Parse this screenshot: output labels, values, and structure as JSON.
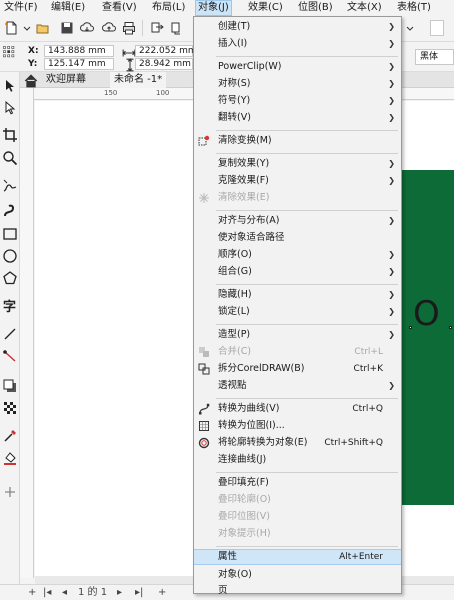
{
  "menubar": {
    "items": [
      "文件(F)",
      "编辑(E)",
      "查看(V)",
      "布局(L)",
      "对象(J)",
      "效果(C)",
      "位图(B)",
      "文本(X)",
      "表格(T)"
    ]
  },
  "propbar": {
    "x_label": "X:",
    "x_value": "143.888 mm",
    "y_label": "Y:",
    "y_value": "125.147 mm",
    "w_value": "222.052 mm",
    "h_value": "28.942 mm",
    "font_name": "黑体"
  },
  "doctabs": {
    "welcome": "欢迎屏幕",
    "untitled": "未命名 -1*"
  },
  "ruler": {
    "h150": "150",
    "h100": "100"
  },
  "canvas": {
    "letter": "O",
    "accent_color": "#0c6b37"
  },
  "pagebar": {
    "page_info": "1 的 1",
    "add_label": "+"
  },
  "dropdown": {
    "items": [
      {
        "label": "创建(T)",
        "shortcut": "",
        "submenu": true,
        "disabled": false
      },
      {
        "label": "插入(I)",
        "shortcut": "",
        "submenu": true,
        "disabled": false
      },
      {
        "label": "PowerClip(W)",
        "shortcut": "",
        "submenu": true,
        "disabled": false
      },
      {
        "label": "对称(S)",
        "shortcut": "",
        "submenu": true,
        "disabled": false
      },
      {
        "label": "符号(Y)",
        "shortcut": "",
        "submenu": true,
        "disabled": false
      },
      {
        "label": "翻转(V)",
        "shortcut": "",
        "submenu": true,
        "disabled": false
      },
      {
        "label": "清除变换(M)",
        "shortcut": "",
        "submenu": false,
        "disabled": false
      },
      {
        "label": "复制效果(Y)",
        "shortcut": "",
        "submenu": true,
        "disabled": false
      },
      {
        "label": "克隆效果(F)",
        "shortcut": "",
        "submenu": true,
        "disabled": false
      },
      {
        "label": "清除效果(E)",
        "shortcut": "",
        "submenu": false,
        "disabled": true
      },
      {
        "label": "对齐与分布(A)",
        "shortcut": "",
        "submenu": true,
        "disabled": false
      },
      {
        "label": "使对象适合路径",
        "shortcut": "",
        "submenu": false,
        "disabled": false
      },
      {
        "label": "顺序(O)",
        "shortcut": "",
        "submenu": true,
        "disabled": false
      },
      {
        "label": "组合(G)",
        "shortcut": "",
        "submenu": true,
        "disabled": false
      },
      {
        "label": "隐藏(H)",
        "shortcut": "",
        "submenu": true,
        "disabled": false
      },
      {
        "label": "锁定(L)",
        "shortcut": "",
        "submenu": true,
        "disabled": false
      },
      {
        "label": "造型(P)",
        "shortcut": "",
        "submenu": true,
        "disabled": false
      },
      {
        "label": "合并(C)",
        "shortcut": "Ctrl+L",
        "submenu": false,
        "disabled": true
      },
      {
        "label": "拆分CorelDRAW(B)",
        "shortcut": "Ctrl+K",
        "submenu": false,
        "disabled": false
      },
      {
        "label": "透视點",
        "shortcut": "",
        "submenu": true,
        "disabled": false
      },
      {
        "label": "转换为曲线(V)",
        "shortcut": "Ctrl+Q",
        "submenu": false,
        "disabled": false
      },
      {
        "label": "转换为位图(I)...",
        "shortcut": "",
        "submenu": false,
        "disabled": false
      },
      {
        "label": "将轮廓转换为对象(E)",
        "shortcut": "Ctrl+Shift+Q",
        "submenu": false,
        "disabled": false
      },
      {
        "label": "连接曲线(J)",
        "shortcut": "",
        "submenu": false,
        "disabled": false
      },
      {
        "label": "叠印填充(F)",
        "shortcut": "",
        "submenu": false,
        "disabled": false
      },
      {
        "label": "叠印轮廓(O)",
        "shortcut": "",
        "submenu": false,
        "disabled": true
      },
      {
        "label": "叠印位图(V)",
        "shortcut": "",
        "submenu": false,
        "disabled": true
      },
      {
        "label": "对象提示(H)",
        "shortcut": "",
        "submenu": false,
        "disabled": true
      },
      {
        "label": "属性",
        "shortcut": "Alt+Enter",
        "submenu": false,
        "disabled": false
      },
      {
        "label": "对象(O)",
        "shortcut": "",
        "submenu": false,
        "disabled": false
      },
      {
        "label": "页",
        "shortcut": "",
        "submenu": false,
        "disabled": false
      }
    ]
  },
  "colors": {
    "highlight": "#cfe5f8",
    "menu_bg": "#f2f2f2"
  }
}
